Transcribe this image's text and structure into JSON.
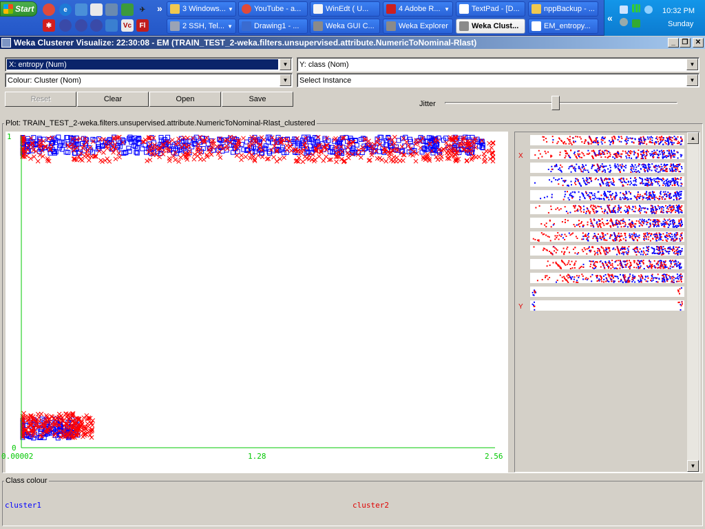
{
  "taskbar": {
    "start_label": "Start",
    "buttons_row1": [
      {
        "label": "3 Windows...",
        "icon": "folder-icon",
        "color": "#f0c850"
      },
      {
        "label": "YouTube - a...",
        "icon": "chrome-icon",
        "color": "#e04a3a"
      },
      {
        "label": "WinEdt  ( U...",
        "icon": "winedt-icon",
        "color": "#f5f5f5"
      },
      {
        "label": "4 Adobe R...",
        "icon": "pdf-icon",
        "color": "#cc1f1f"
      },
      {
        "label": "TextPad - [D...",
        "icon": "textpad-icon",
        "color": "#ffffff"
      },
      {
        "label": "nppBackup - ...",
        "icon": "folder-icon",
        "color": "#f0c850"
      }
    ],
    "buttons_row2": [
      {
        "label": "2 SSH, Tel...",
        "icon": "ssh-icon",
        "color": "#9aa3b5"
      },
      {
        "label": "Drawing1 - ...",
        "icon": "visio-icon",
        "color": "#3a6bd0"
      },
      {
        "label": "Weka GUI C...",
        "icon": "weka-icon",
        "color": "#8a8a8a"
      },
      {
        "label": "Weka Explorer",
        "icon": "weka-icon",
        "color": "#8a8a8a"
      },
      {
        "label": "Weka Clust...",
        "icon": "weka-icon",
        "color": "#8a8a8a"
      },
      {
        "label": "EM_entropy...",
        "icon": "document-icon",
        "color": "#ffffff"
      }
    ],
    "clock_time": "10:32 PM",
    "clock_day": "Sunday"
  },
  "window": {
    "title": "Weka Clusterer Visualize: 22:30:08 - EM (TRAIN_TEST_2-weka.filters.unsupervised.attribute.NumericToNominal-Rlast)"
  },
  "controls": {
    "x_axis": "X: entropy (Num)",
    "y_axis": "Y: class (Nom)",
    "colour": "Colour: Cluster (Nom)",
    "select_instance": "Select Instance",
    "reset_label": "Reset",
    "clear_label": "Clear",
    "open_label": "Open",
    "save_label": "Save",
    "jitter_label": "Jitter",
    "jitter_value": 0.5
  },
  "plot": {
    "title": "Plot: TRAIN_TEST_2-weka.filters.unsupervised.attribute.NumericToNominal-Rlast_clustered",
    "x_ticks": [
      "0.00002",
      "1.28",
      "2.56"
    ],
    "y_ticks": [
      "1",
      "0"
    ],
    "attr_x_mark": "X",
    "attr_y_mark": "Y"
  },
  "chart_data": {
    "type": "scatter",
    "title": "Plot: TRAIN_TEST_2-weka.filters.unsupervised.attribute.NumericToNominal-Rlast_clustered",
    "xlabel": "entropy",
    "ylabel": "class",
    "xlim": [
      2e-05,
      2.56
    ],
    "y_categories": [
      "0",
      "1"
    ],
    "series": [
      {
        "name": "cluster1",
        "color": "#0000ff",
        "marker": "square",
        "points": [
          [
            0.05,
            1
          ],
          [
            0.3,
            1
          ],
          [
            0.6,
            1
          ],
          [
            0.9,
            1
          ],
          [
            1.2,
            1
          ],
          [
            1.5,
            1
          ],
          [
            1.8,
            1
          ],
          [
            2.1,
            1
          ],
          [
            2.35,
            1
          ],
          [
            0.02,
            0
          ],
          [
            0.15,
            0
          ],
          [
            0.25,
            0
          ]
        ]
      },
      {
        "name": "cluster2",
        "color": "#ff0000",
        "marker": "cross",
        "points": [
          [
            0.02,
            1
          ],
          [
            0.4,
            1
          ],
          [
            0.8,
            1
          ],
          [
            1.1,
            1
          ],
          [
            1.4,
            1
          ],
          [
            1.7,
            1
          ],
          [
            2.0,
            1
          ],
          [
            2.3,
            1
          ],
          [
            2.45,
            1
          ],
          [
            0.01,
            0
          ],
          [
            0.1,
            0
          ],
          [
            0.2,
            0
          ],
          [
            0.3,
            0
          ],
          [
            0.33,
            0
          ]
        ]
      }
    ],
    "attribute_bars": 13
  },
  "legend": {
    "label": "Class colour",
    "items": [
      {
        "name": "cluster1",
        "color": "#0000ff"
      },
      {
        "name": "cluster2",
        "color": "#e00000"
      }
    ]
  }
}
